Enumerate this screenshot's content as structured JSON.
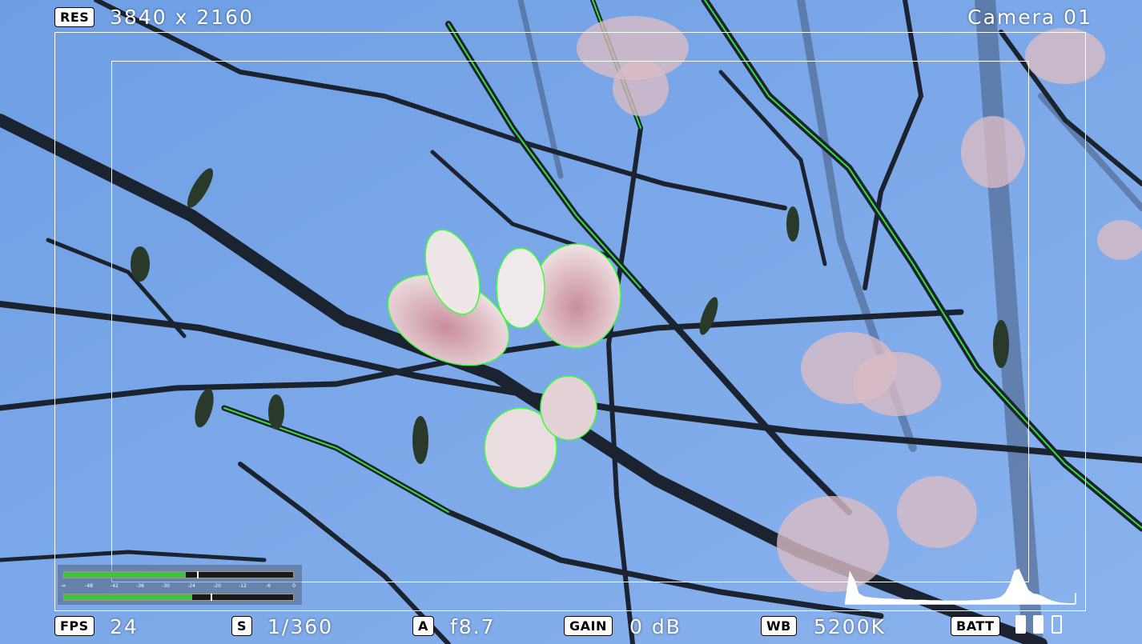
{
  "top_left": {
    "res_label": "RES",
    "resolution": "3840 x 2160"
  },
  "top_right": {
    "camera_name": "Camera 01"
  },
  "bottom_bar": {
    "fps": {
      "label": "FPS",
      "value": "24"
    },
    "shutter": {
      "label": "S",
      "value": "1/360"
    },
    "aperture": {
      "label": "A",
      "value": "f8.7"
    },
    "gain": {
      "label": "GAIN",
      "value": "0 dB"
    },
    "white_balance": {
      "label": "WB",
      "value": "5200K"
    },
    "battery": {
      "label": "BATT",
      "cells": [
        true,
        true,
        false
      ]
    }
  },
  "audio_meter": {
    "scale": [
      "-∞",
      "-48",
      "-42",
      "-36",
      "-30",
      "-24",
      "-20",
      "-12",
      "-6",
      "0"
    ],
    "channels": [
      {
        "level": 0.53,
        "peak": 0.58
      },
      {
        "level": 0.56,
        "peak": 0.64
      }
    ],
    "colors": {
      "fill": "#3cc43c",
      "background": "#1a1a1a"
    }
  },
  "histogram": {
    "values": [
      0.05,
      0.95,
      0.7,
      0.3,
      0.22,
      0.2,
      0.18,
      0.17,
      0.16,
      0.15,
      0.15,
      0.14,
      0.14,
      0.13,
      0.13,
      0.12,
      0.12,
      0.12,
      0.11,
      0.11,
      0.11,
      0.1,
      0.1,
      0.1,
      0.1,
      0.1,
      0.1,
      0.11,
      0.11,
      0.12,
      0.13,
      0.14,
      0.16,
      0.2,
      0.3,
      0.55,
      0.95,
      1.0,
      0.7,
      0.4,
      0.3,
      0.28,
      0.22,
      0.15,
      0.1,
      0.06,
      0.04,
      0.03,
      0.02,
      0.02
    ]
  },
  "colors": {
    "sky": "#7aa6e6",
    "branches": "#1b2330",
    "petals": "#e8d4d8",
    "focus_peaking": "#39ff39",
    "osd": "#ffffff"
  }
}
